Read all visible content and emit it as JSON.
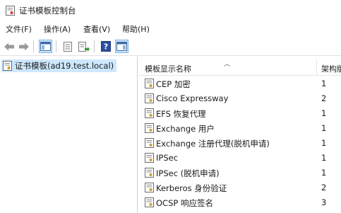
{
  "window": {
    "title": "证书模板控制台"
  },
  "menu": [
    {
      "label": "文件(F)"
    },
    {
      "label": "操作(A)"
    },
    {
      "label": "查看(V)"
    },
    {
      "label": "帮助(H)"
    }
  ],
  "toolbar": {
    "buttons": [
      "back-arrow-icon",
      "forward-arrow-icon",
      "console-tree-icon",
      "properties-icon",
      "export-list-icon",
      "help-icon",
      "action-pane-icon"
    ]
  },
  "tree": {
    "root_label": "证书模板(ad19.test.local)"
  },
  "list": {
    "columns": [
      "模板显示名称",
      "架构版"
    ],
    "rows": [
      {
        "name": "CEP 加密",
        "version": "1"
      },
      {
        "name": "Cisco Expressway",
        "version": "2"
      },
      {
        "name": "EFS 恢复代理",
        "version": "1"
      },
      {
        "name": "Exchange 用户",
        "version": "1"
      },
      {
        "name": "Exchange 注册代理(脱机申请)",
        "version": "1"
      },
      {
        "name": "IPSec",
        "version": "1"
      },
      {
        "name": "IPSec (脱机申请)",
        "version": "1"
      },
      {
        "name": "Kerberos 身份验证",
        "version": "2"
      },
      {
        "name": "OCSP 响应签名",
        "version": "3"
      }
    ]
  }
}
